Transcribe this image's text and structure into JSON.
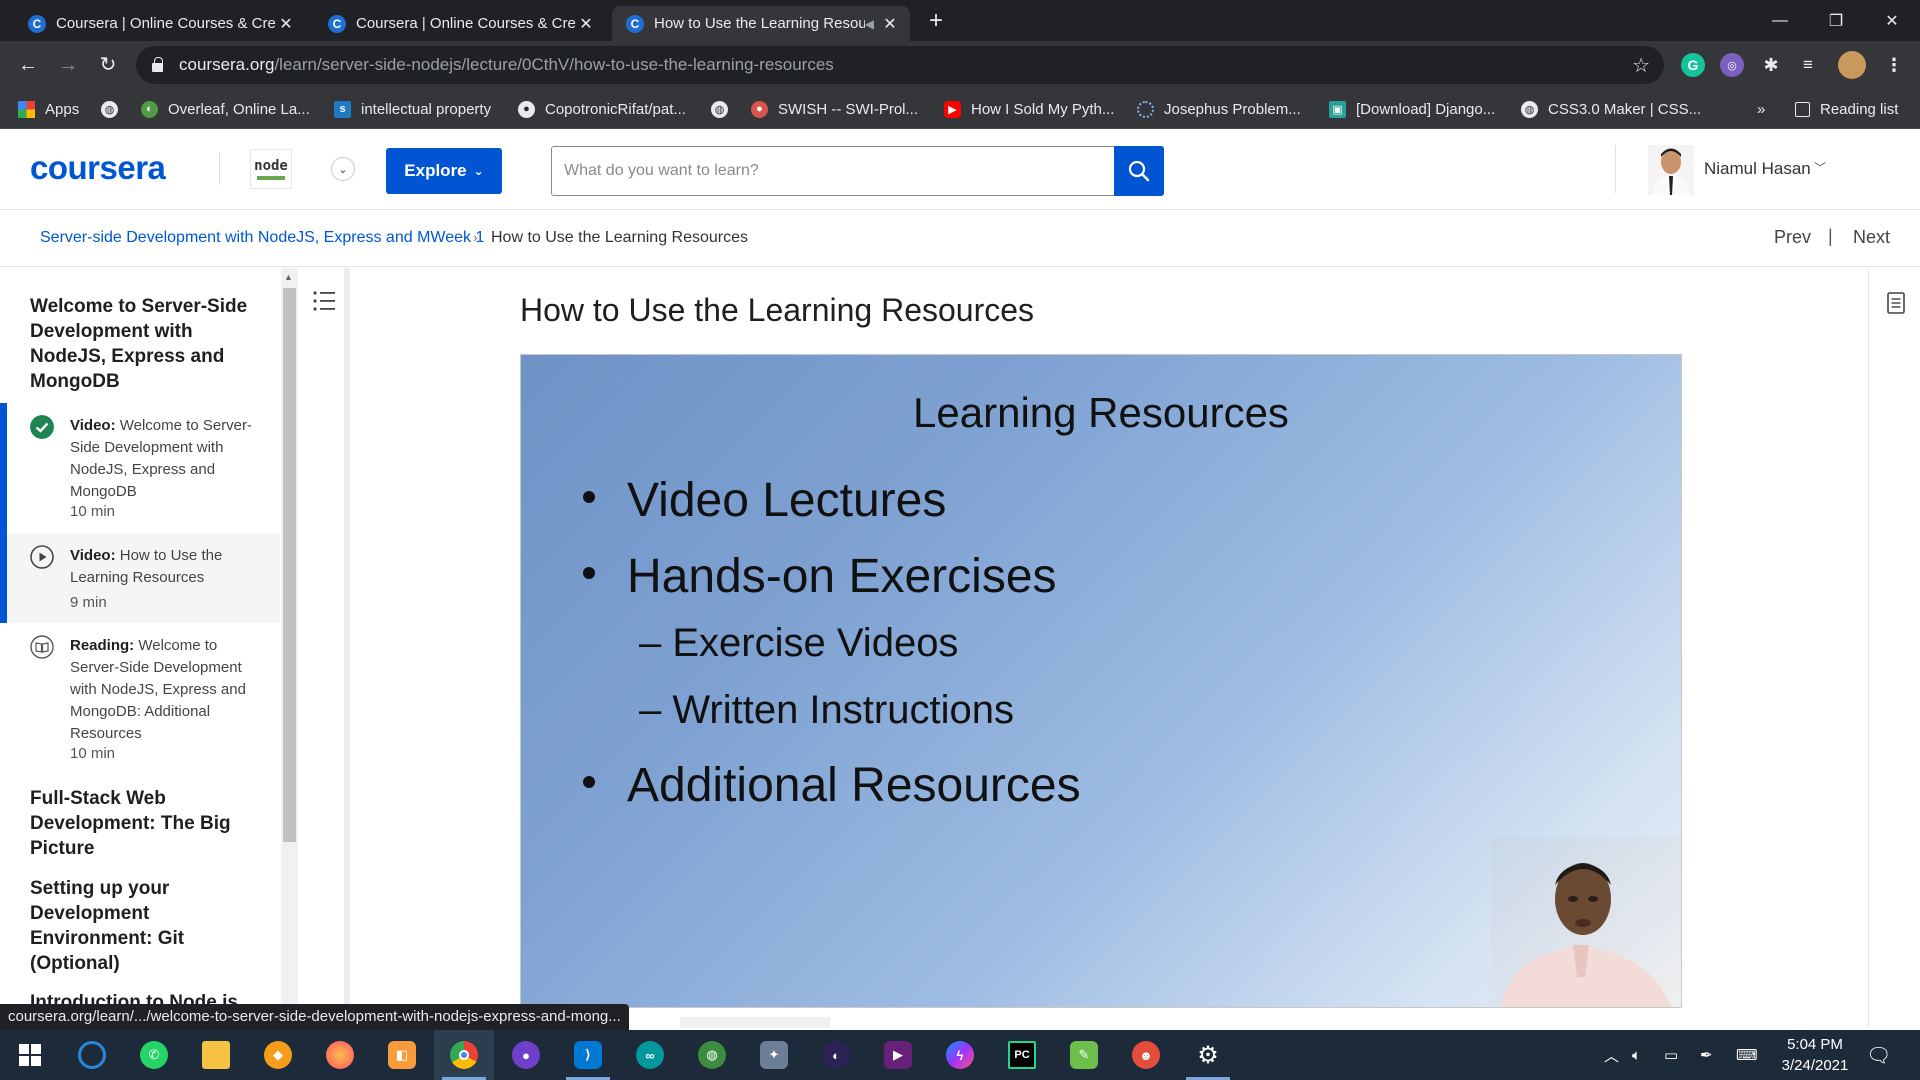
{
  "browser": {
    "tabs": [
      {
        "title": "Coursera | Online Courses & Credentials",
        "active": false
      },
      {
        "title": "Coursera | Online Courses & Credentials",
        "active": false
      },
      {
        "title": "How to Use the Learning Resources",
        "active": true
      }
    ],
    "url_host": "coursera.org",
    "url_path": "/learn/server-side-nodejs/lecture/0CthV/how-to-use-the-learning-resources",
    "bookmarks": [
      {
        "label": "Apps",
        "icon": "apps-grid-icon"
      },
      {
        "label": "",
        "icon": "globe-icon"
      },
      {
        "label": "Overleaf, Online La...",
        "icon": "overleaf-icon"
      },
      {
        "label": "intellectual property",
        "icon": "scribd-icon"
      },
      {
        "label": "CopotronicRifat/pat...",
        "icon": "github-icon"
      },
      {
        "label": "",
        "icon": "globe-icon"
      },
      {
        "label": "SWISH -- SWI-Prol...",
        "icon": "swish-icon"
      },
      {
        "label": "How I Sold My Pyth...",
        "icon": "youtube-icon"
      },
      {
        "label": "Josephus Problem...",
        "icon": "loading-icon"
      },
      {
        "label": "[Download] Django...",
        "icon": "download-site-icon"
      },
      {
        "label": "CSS3.0 Maker | CSS...",
        "icon": "globe-icon"
      }
    ],
    "bookmarks_overflow": "»",
    "reading_list": "Reading list"
  },
  "header": {
    "logo": "coursera",
    "partner_logo_text": "node",
    "explore_label": "Explore",
    "search_placeholder": "What do you want to learn?",
    "user_name": "Niamul Hasan"
  },
  "breadcrumb": {
    "course": "Server-side Development with NodeJS, Express and M",
    "week": "Week 1",
    "current": "How to Use the Learning Resources",
    "prev": "Prev",
    "separator": "|",
    "next": "Next"
  },
  "sidebar": {
    "week_title": "Welcome to Server-Side Development with NodeJS, Express and MongoDB",
    "items": [
      {
        "type": "Video:",
        "title": "Welcome to Server-Side Development with NodeJS, Express and MongoDB",
        "duration": "10 min",
        "status": "completed"
      },
      {
        "type": "Video:",
        "title": "How to Use the Learning Resources",
        "duration": "9 min",
        "status": "current"
      },
      {
        "type": "Reading:",
        "title": "Welcome to Server-Side Development with NodeJS, Express and MongoDB: Additional Resources",
        "duration": "10 min",
        "status": "reading"
      }
    ],
    "sections": [
      "Full-Stack Web Development: The Big Picture",
      "Setting up your Development Environment: Git (Optional)",
      "Introduction to Node.js"
    ]
  },
  "main": {
    "lesson_title": "How to Use the Learning Resources",
    "slide": {
      "title": "Learning Resources",
      "bullets": [
        "Video Lectures",
        "Hands-on Exercises",
        "Additional Resources"
      ],
      "sub_bullets": [
        "– Exercise Videos",
        "– Written Instructions"
      ]
    }
  },
  "status_url": "coursera.org/learn/.../welcome-to-server-side-development-with-nodejs-express-and-mong...",
  "taskbar": {
    "time": "5:04 PM",
    "date": "3/24/2021"
  },
  "colors": {
    "brand": "#0056d2",
    "chrome_dark": "#202124",
    "chrome_mid": "#35363a",
    "completed_green": "#1f8354",
    "taskbar": "#1c2a3a"
  }
}
